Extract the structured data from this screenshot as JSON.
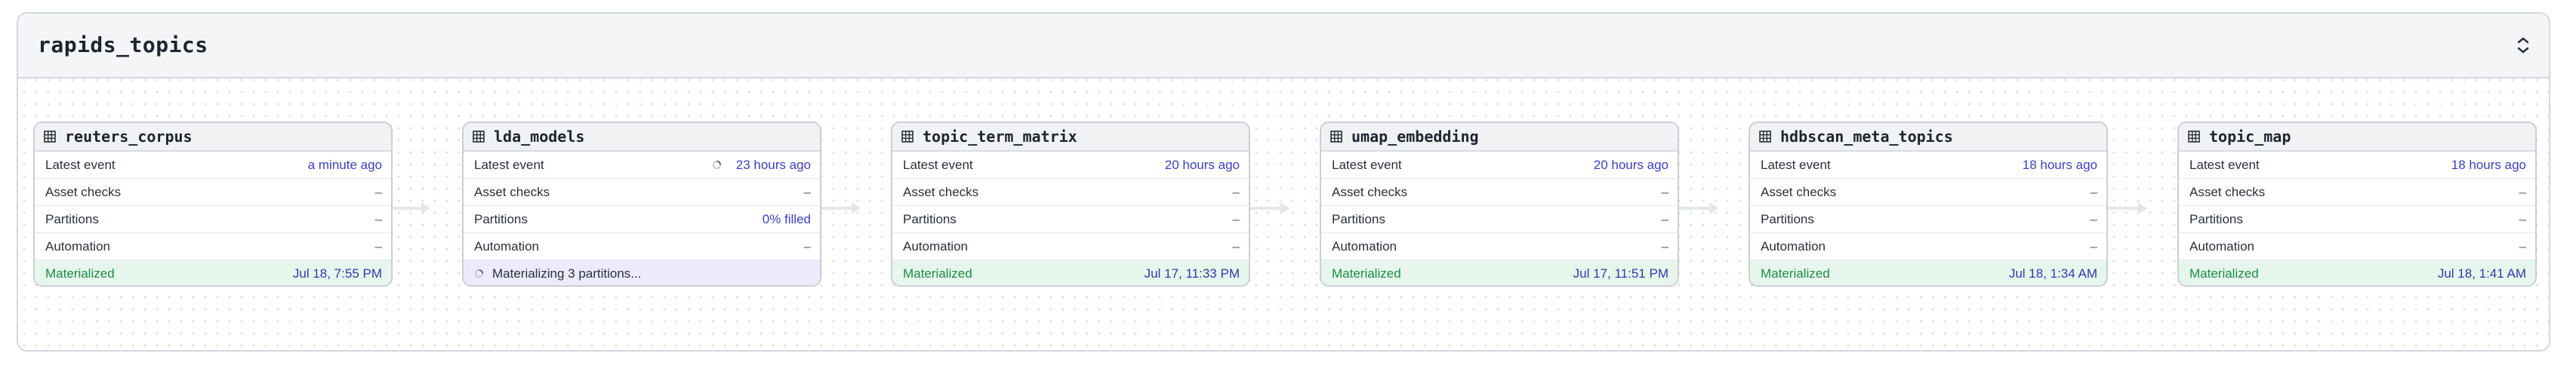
{
  "group": {
    "title": "rapids_topics"
  },
  "labels": {
    "latest_event": "Latest event",
    "asset_checks": "Asset checks",
    "partitions": "Partitions",
    "automation": "Automation"
  },
  "assets": [
    {
      "name": "reuters_corpus",
      "latest_event": "a minute ago",
      "asset_checks": "–",
      "partitions": "–",
      "automation": "–",
      "status_label": "Materialized",
      "status_time": "Jul 18, 7:55 PM"
    },
    {
      "name": "lda_models",
      "latest_event": "23 hours ago",
      "asset_checks": "–",
      "partitions": "0% filled",
      "automation": "–",
      "status_label": "Materializing 3 partitions..."
    },
    {
      "name": "topic_term_matrix",
      "latest_event": "20 hours ago",
      "asset_checks": "–",
      "partitions": "–",
      "automation": "–",
      "status_label": "Materialized",
      "status_time": "Jul 17, 11:33 PM"
    },
    {
      "name": "umap_embedding",
      "latest_event": "20 hours ago",
      "asset_checks": "–",
      "partitions": "–",
      "automation": "–",
      "status_label": "Materialized",
      "status_time": "Jul 17, 11:51 PM"
    },
    {
      "name": "hdbscan_meta_topics",
      "latest_event": "18 hours ago",
      "asset_checks": "–",
      "partitions": "–",
      "automation": "–",
      "status_label": "Materialized",
      "status_time": "Jul 18, 1:34 AM"
    },
    {
      "name": "topic_map",
      "latest_event": "18 hours ago",
      "asset_checks": "–",
      "partitions": "–",
      "automation": "–",
      "status_label": "Materialized",
      "status_time": "Jul 18, 1:41 AM"
    }
  ],
  "icons": {
    "asset": "table-icon",
    "collapse": "collapse-chevrons-icon",
    "loading": "spinner-icon"
  },
  "colors": {
    "materialized_bg": "#e7f6ec",
    "materialized_text": "#1b8b43",
    "materializing_bg": "#ecebfa",
    "link_text": "#3c3fc0"
  }
}
